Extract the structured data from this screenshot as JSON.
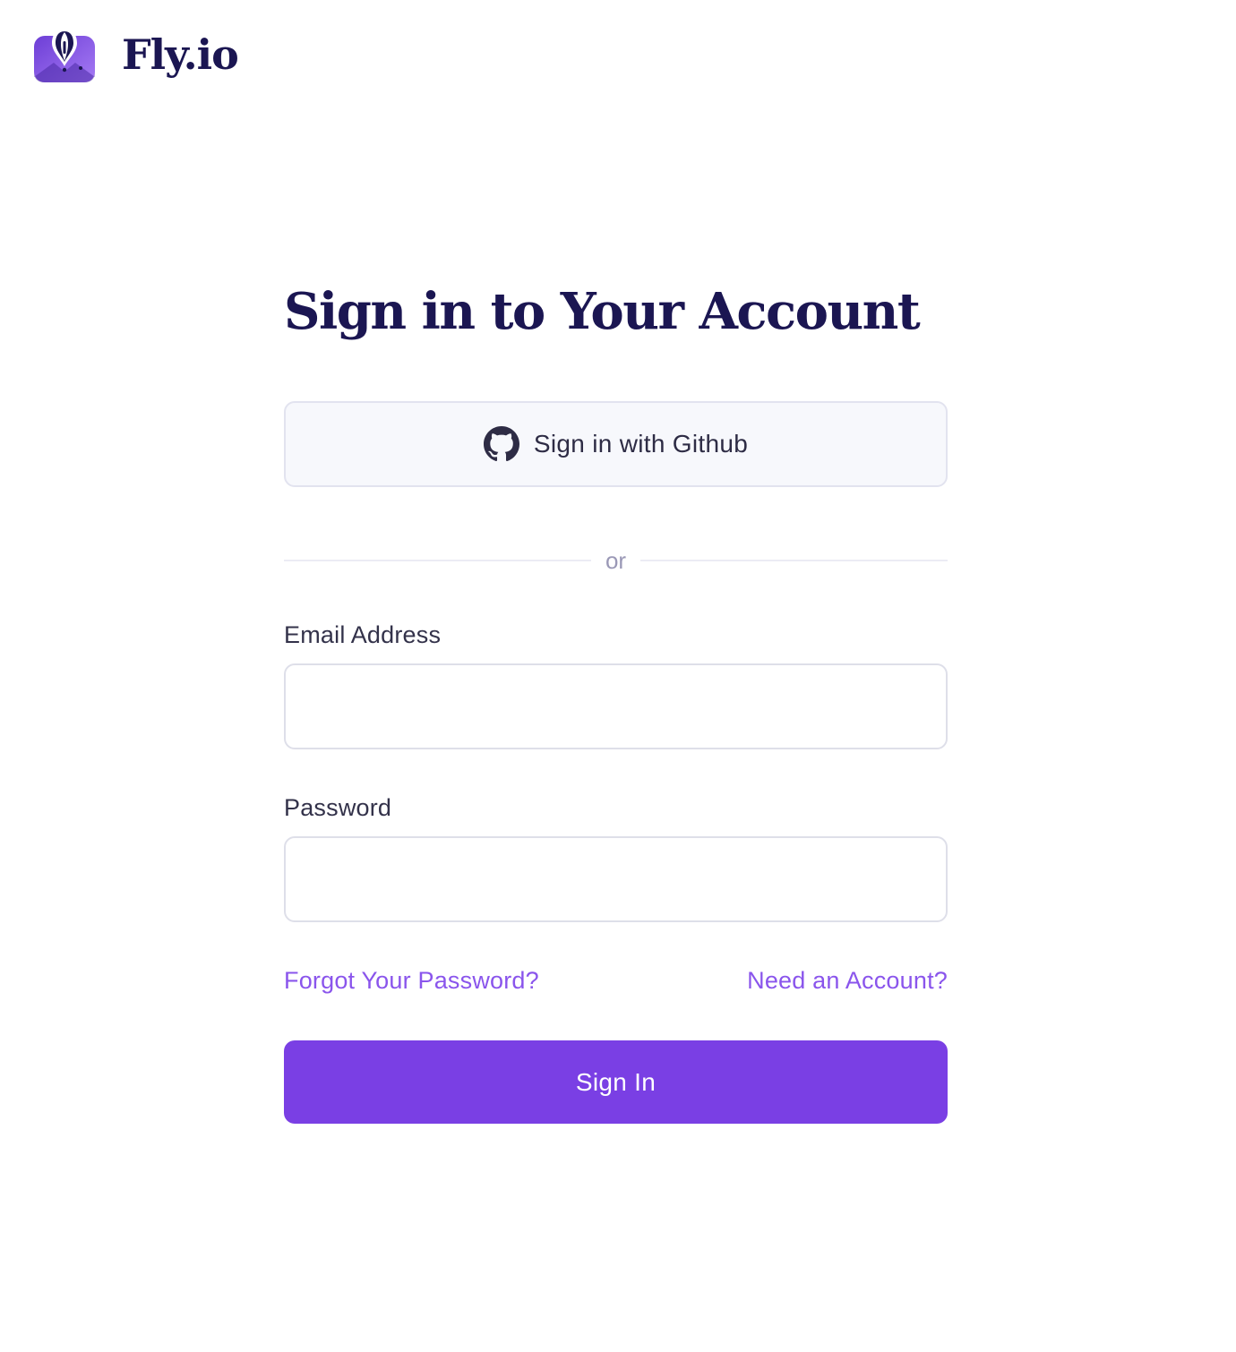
{
  "brand": {
    "name": "Fly.io",
    "colors": {
      "logo_gradient_start": "#6d3ed6",
      "logo_gradient_end": "#a57af4",
      "text": "#1b1652"
    }
  },
  "page": {
    "title": "Sign in to Your Account"
  },
  "github": {
    "label": "Sign in with Github",
    "icon": "github-icon"
  },
  "divider": {
    "text": "or"
  },
  "form": {
    "email": {
      "label": "Email Address",
      "value": "",
      "placeholder": ""
    },
    "password": {
      "label": "Password",
      "value": "",
      "placeholder": ""
    },
    "forgot_link": "Forgot Your Password?",
    "signup_link": "Need an Account?",
    "submit_label": "Sign In"
  },
  "colors": {
    "accent": "#7a3fe4",
    "link": "#8a55ec",
    "heading": "#1b1652"
  }
}
